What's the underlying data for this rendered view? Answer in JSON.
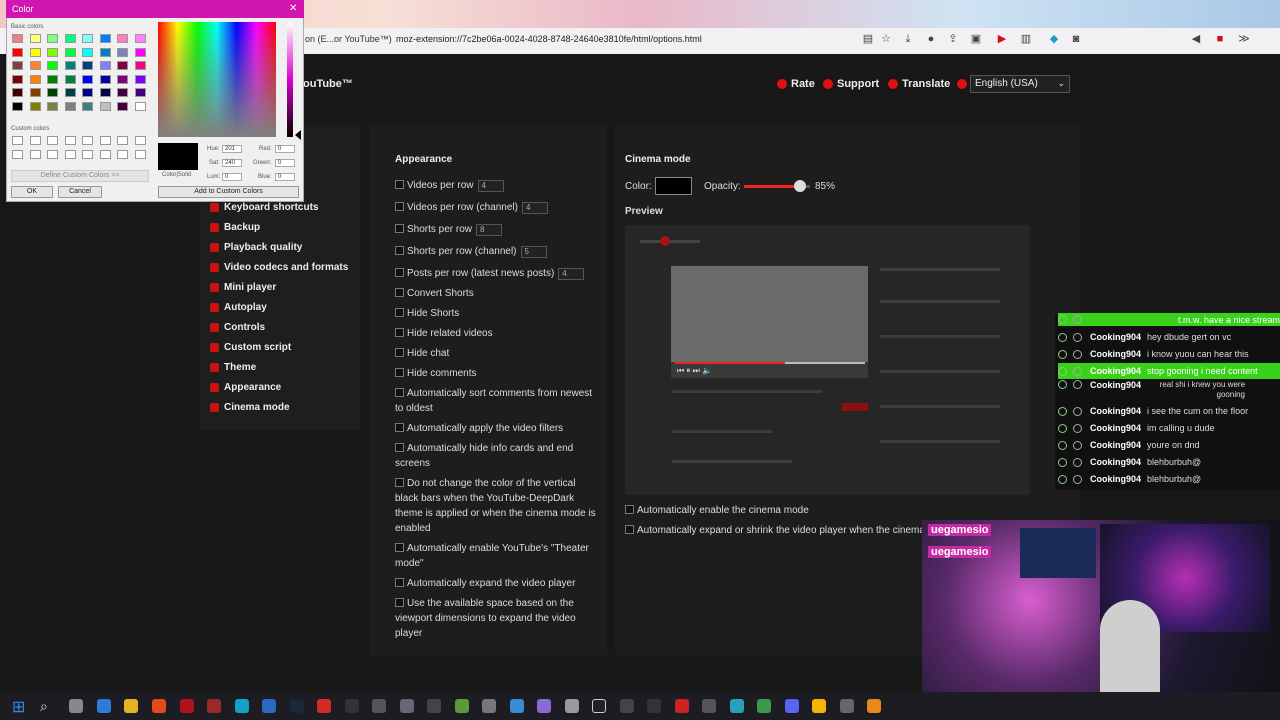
{
  "browser": {
    "tab_title": "on (E...or YouTube™)",
    "url": "moz-extension://7c2be06a-0024-4028-8748-24640e3810fe/html/options.html"
  },
  "header": {
    "title": "ouTube™",
    "rate": "Rate",
    "support": "Support",
    "translate": "Translate",
    "language": "English (USA)"
  },
  "sidebar": {
    "items": [
      {
        "label": "Keyboard shortcuts"
      },
      {
        "label": "Backup"
      },
      {
        "label": "Playback quality"
      },
      {
        "label": "Video codecs and formats"
      },
      {
        "label": "Mini player"
      },
      {
        "label": "Autoplay"
      },
      {
        "label": "Controls"
      },
      {
        "label": "Custom script"
      },
      {
        "label": "Theme"
      },
      {
        "label": "Appearance"
      },
      {
        "label": "Cinema mode"
      }
    ]
  },
  "appearance": {
    "title": "Appearance",
    "options": [
      {
        "label": "Videos per row",
        "value": "4"
      },
      {
        "label": "Videos per row (channel)",
        "value": "4"
      },
      {
        "label": "Shorts per row",
        "value": "8"
      },
      {
        "label": "Shorts per row (channel)",
        "value": "5"
      },
      {
        "label": "Posts per row (latest news posts)",
        "value": "4"
      },
      {
        "label": "Convert Shorts"
      },
      {
        "label": "Hide Shorts"
      },
      {
        "label": "Hide related videos"
      },
      {
        "label": "Hide chat"
      },
      {
        "label": "Hide comments"
      },
      {
        "label": "Automatically sort comments from newest to oldest"
      },
      {
        "label": "Automatically apply the video filters"
      },
      {
        "label": "Automatically hide info cards and end screens"
      },
      {
        "label": "Do not change the color of the vertical black bars when the YouTube-DeepDark theme is applied or when the cinema mode is enabled"
      },
      {
        "label": "Automatically enable YouTube's \"Theater mode\""
      },
      {
        "label": "Automatically expand the video player"
      },
      {
        "label": "Use the available space based on the viewport dimensions to expand the video player"
      }
    ]
  },
  "cinema": {
    "title": "Cinema mode",
    "color_label": "Color:",
    "opacity_label": "Opacity:",
    "opacity_value": "85%",
    "opacity_fraction": 0.85,
    "preview_label": "Preview",
    "opt1": "Automatically enable the cinema mode",
    "opt2": "Automatically expand or shrink the video player when the cinema"
  },
  "chat": [
    {
      "user": "",
      "msg": "t.m.w. have a nice stream",
      "highlight": true
    },
    {
      "user": "Cooking904",
      "msg": "hey dbude gert on vc"
    },
    {
      "user": "Cooking904",
      "msg": "i know yuou can hear this"
    },
    {
      "user": "Cooking904",
      "msg": "stop gooning i need content",
      "highlight": true
    },
    {
      "user": "Cooking904",
      "msg": "real shi i knew you were gooning"
    },
    {
      "user": "Cooking904",
      "msg": "i see the cum on the floor"
    },
    {
      "user": "Cooking904",
      "msg": "im calling u dude"
    },
    {
      "user": "Cooking904",
      "msg": "youre on dnd"
    },
    {
      "user": "Cooking904",
      "msg": "blehburbuh@"
    },
    {
      "user": "Cooking904",
      "msg": "blehburbuh@"
    }
  ],
  "webcam": {
    "label1": "uegamesio",
    "label2": "uegamesio"
  },
  "color_dialog": {
    "title": "Color",
    "basic_colors": "Basic colors",
    "custom_colors": "Custom colors",
    "define_custom": "Define Custom Colors >>",
    "ok": "OK",
    "cancel": "Cancel",
    "add_custom": "Add to Custom Colors",
    "color_solid": "Color|Solid",
    "hue_label": "Hue:",
    "hue": "201",
    "sat_label": "Sat:",
    "sat": "240",
    "lum_label": "Lum:",
    "lum": "0",
    "red_label": "Red:",
    "red": "0",
    "green_label": "Green:",
    "green": "0",
    "blue_label": "Blue:",
    "blue": "0",
    "swatches": [
      "#f08080",
      "#ffff80",
      "#80ff80",
      "#00ff80",
      "#80ffff",
      "#0080ff",
      "#ff80c0",
      "#ff80ff",
      "#ff0000",
      "#ffff00",
      "#80ff00",
      "#00ff40",
      "#00ffff",
      "#0080c0",
      "#8080c0",
      "#ff00ff",
      "#804040",
      "#ff8040",
      "#00ff00",
      "#008080",
      "#004080",
      "#8080ff",
      "#800040",
      "#ff0080",
      "#800000",
      "#ff8000",
      "#008000",
      "#008040",
      "#0000ff",
      "#0000a0",
      "#800080",
      "#8000ff",
      "#400000",
      "#804000",
      "#004000",
      "#004040",
      "#000080",
      "#000040",
      "#400040",
      "#400080",
      "#000000",
      "#808000",
      "#808040",
      "#808080",
      "#408080",
      "#c0c0c0",
      "#400040",
      "#ffffff"
    ]
  }
}
